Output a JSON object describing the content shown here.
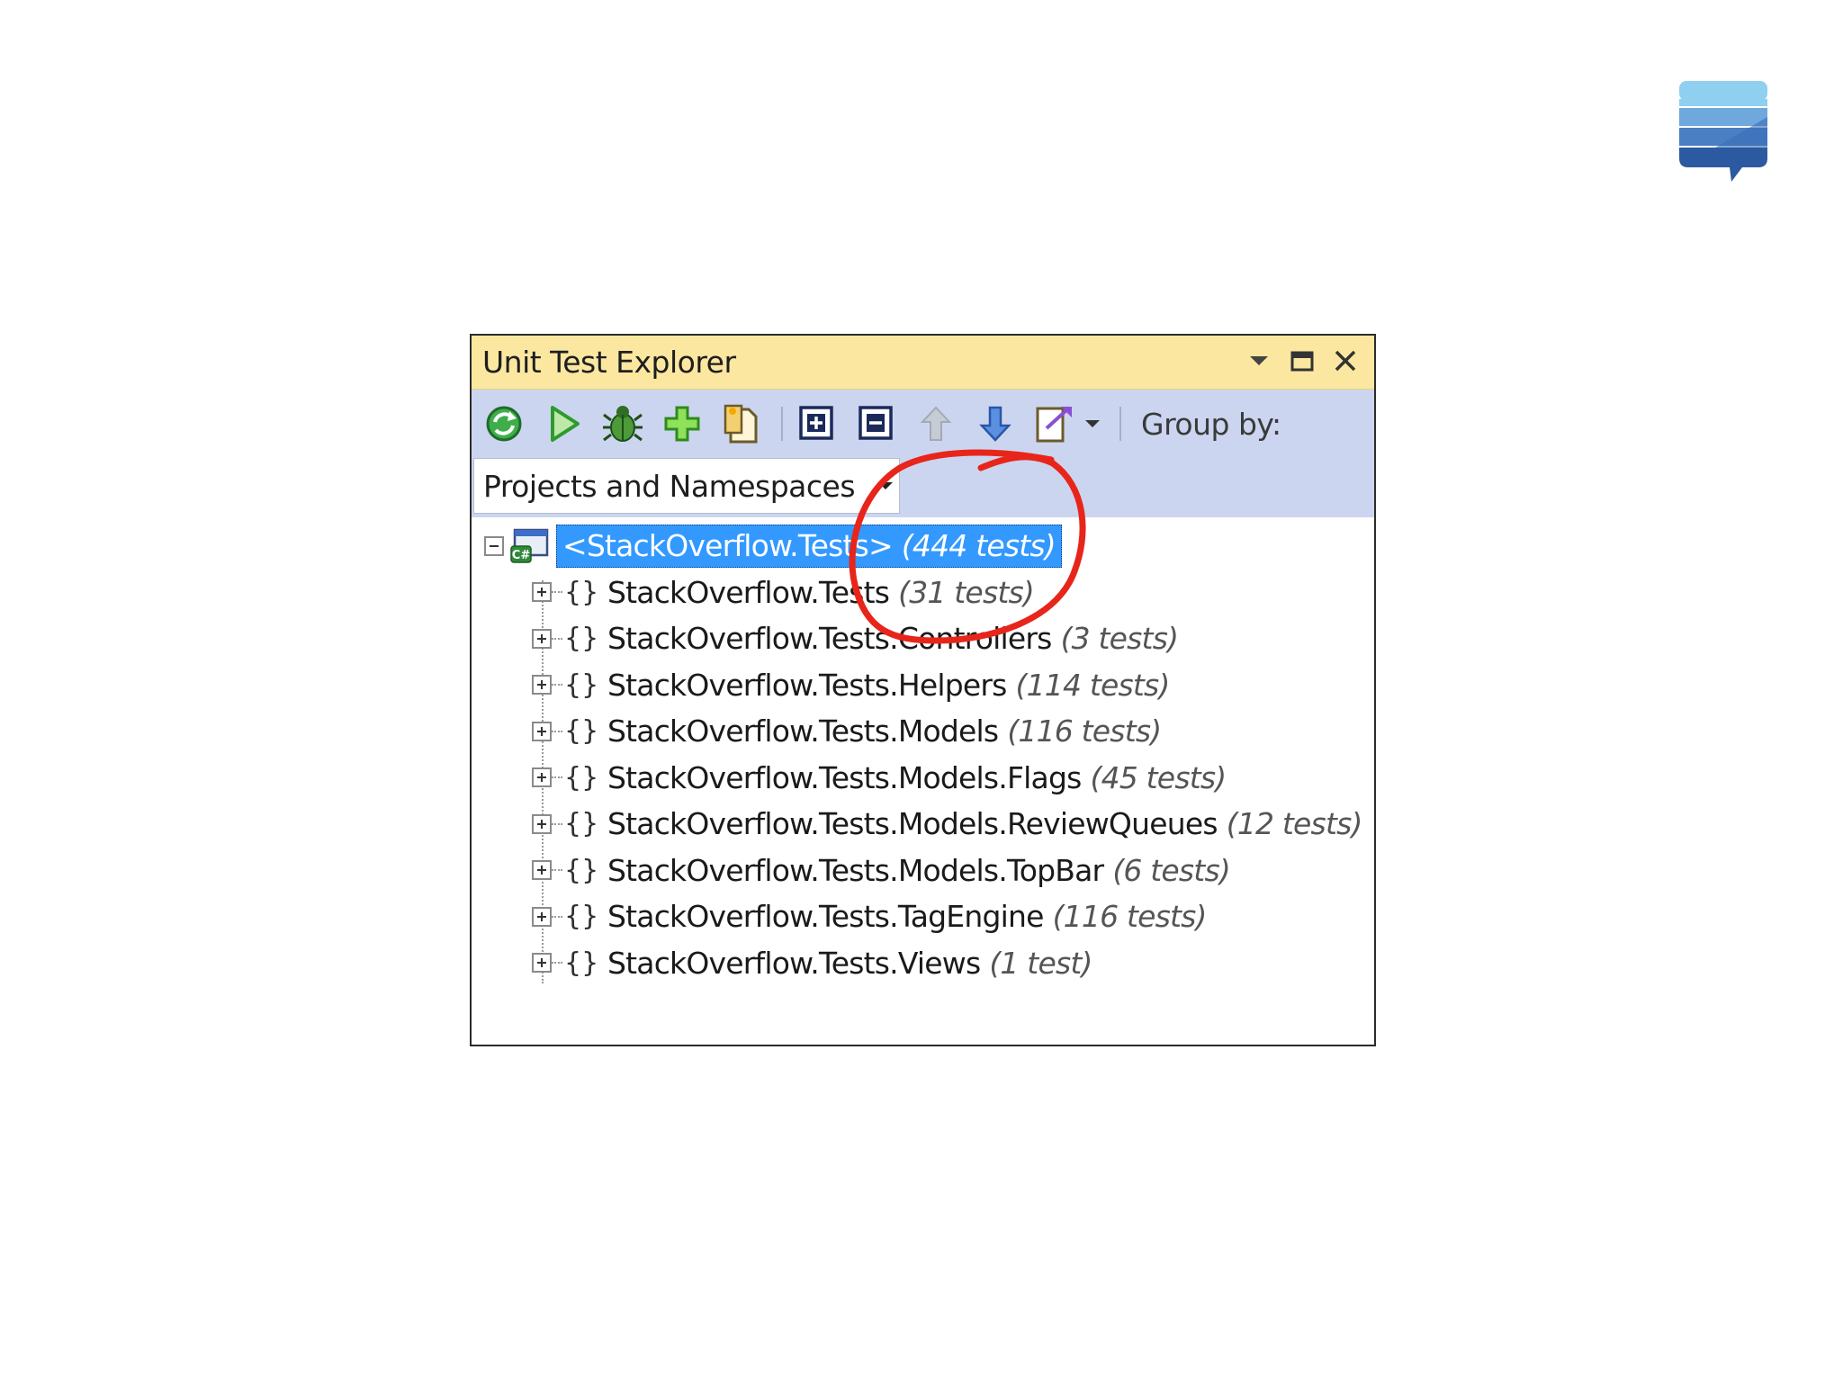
{
  "window": {
    "title": "Unit Test Explorer"
  },
  "toolbar": {
    "group_by_label": "Group by:"
  },
  "filter": {
    "selected": "Projects and Namespaces"
  },
  "tree": {
    "root": {
      "label": "<StackOverflow.Tests>",
      "count": "(444 tests)"
    },
    "children": [
      {
        "label": "StackOverflow.Tests",
        "count": "(31 tests)"
      },
      {
        "label": "StackOverflow.Tests.Controllers",
        "count": "(3 tests)"
      },
      {
        "label": "StackOverflow.Tests.Helpers",
        "count": "(114 tests)"
      },
      {
        "label": "StackOverflow.Tests.Models",
        "count": "(116 tests)"
      },
      {
        "label": "StackOverflow.Tests.Models.Flags",
        "count": "(45 tests)"
      },
      {
        "label": "StackOverflow.Tests.Models.ReviewQueues",
        "count": "(12 tests)"
      },
      {
        "label": "StackOverflow.Tests.Models.TopBar",
        "count": "(6 tests)"
      },
      {
        "label": "StackOverflow.Tests.TagEngine",
        "count": "(116 tests)"
      },
      {
        "label": "StackOverflow.Tests.Views",
        "count": "(1 test)"
      }
    ]
  },
  "colors": {
    "title_bar": "#fbe7a0",
    "toolbar": "#ccd5f0",
    "selection": "#3399ff",
    "annotation": "#e8251a"
  },
  "icons": {
    "namespace": "{}"
  }
}
